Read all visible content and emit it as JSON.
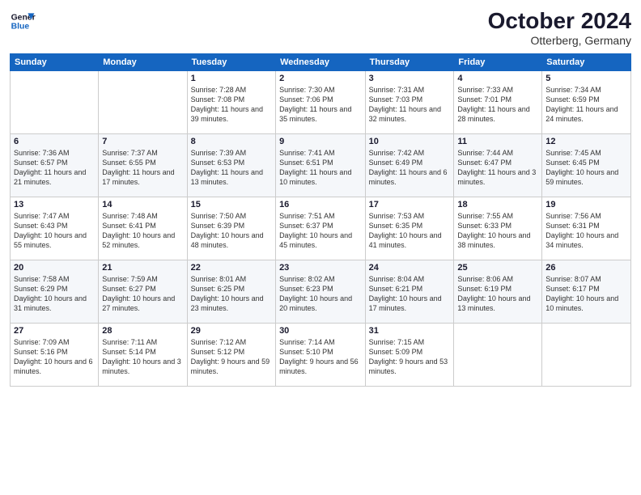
{
  "logo": {
    "line1": "General",
    "line2": "Blue"
  },
  "title": "October 2024",
  "location": "Otterberg, Germany",
  "weekdays": [
    "Sunday",
    "Monday",
    "Tuesday",
    "Wednesday",
    "Thursday",
    "Friday",
    "Saturday"
  ],
  "weeks": [
    [
      {
        "day": "",
        "info": ""
      },
      {
        "day": "",
        "info": ""
      },
      {
        "day": "1",
        "info": "Sunrise: 7:28 AM\nSunset: 7:08 PM\nDaylight: 11 hours and 39 minutes."
      },
      {
        "day": "2",
        "info": "Sunrise: 7:30 AM\nSunset: 7:06 PM\nDaylight: 11 hours and 35 minutes."
      },
      {
        "day": "3",
        "info": "Sunrise: 7:31 AM\nSunset: 7:03 PM\nDaylight: 11 hours and 32 minutes."
      },
      {
        "day": "4",
        "info": "Sunrise: 7:33 AM\nSunset: 7:01 PM\nDaylight: 11 hours and 28 minutes."
      },
      {
        "day": "5",
        "info": "Sunrise: 7:34 AM\nSunset: 6:59 PM\nDaylight: 11 hours and 24 minutes."
      }
    ],
    [
      {
        "day": "6",
        "info": "Sunrise: 7:36 AM\nSunset: 6:57 PM\nDaylight: 11 hours and 21 minutes."
      },
      {
        "day": "7",
        "info": "Sunrise: 7:37 AM\nSunset: 6:55 PM\nDaylight: 11 hours and 17 minutes."
      },
      {
        "day": "8",
        "info": "Sunrise: 7:39 AM\nSunset: 6:53 PM\nDaylight: 11 hours and 13 minutes."
      },
      {
        "day": "9",
        "info": "Sunrise: 7:41 AM\nSunset: 6:51 PM\nDaylight: 11 hours and 10 minutes."
      },
      {
        "day": "10",
        "info": "Sunrise: 7:42 AM\nSunset: 6:49 PM\nDaylight: 11 hours and 6 minutes."
      },
      {
        "day": "11",
        "info": "Sunrise: 7:44 AM\nSunset: 6:47 PM\nDaylight: 11 hours and 3 minutes."
      },
      {
        "day": "12",
        "info": "Sunrise: 7:45 AM\nSunset: 6:45 PM\nDaylight: 10 hours and 59 minutes."
      }
    ],
    [
      {
        "day": "13",
        "info": "Sunrise: 7:47 AM\nSunset: 6:43 PM\nDaylight: 10 hours and 55 minutes."
      },
      {
        "day": "14",
        "info": "Sunrise: 7:48 AM\nSunset: 6:41 PM\nDaylight: 10 hours and 52 minutes."
      },
      {
        "day": "15",
        "info": "Sunrise: 7:50 AM\nSunset: 6:39 PM\nDaylight: 10 hours and 48 minutes."
      },
      {
        "day": "16",
        "info": "Sunrise: 7:51 AM\nSunset: 6:37 PM\nDaylight: 10 hours and 45 minutes."
      },
      {
        "day": "17",
        "info": "Sunrise: 7:53 AM\nSunset: 6:35 PM\nDaylight: 10 hours and 41 minutes."
      },
      {
        "day": "18",
        "info": "Sunrise: 7:55 AM\nSunset: 6:33 PM\nDaylight: 10 hours and 38 minutes."
      },
      {
        "day": "19",
        "info": "Sunrise: 7:56 AM\nSunset: 6:31 PM\nDaylight: 10 hours and 34 minutes."
      }
    ],
    [
      {
        "day": "20",
        "info": "Sunrise: 7:58 AM\nSunset: 6:29 PM\nDaylight: 10 hours and 31 minutes."
      },
      {
        "day": "21",
        "info": "Sunrise: 7:59 AM\nSunset: 6:27 PM\nDaylight: 10 hours and 27 minutes."
      },
      {
        "day": "22",
        "info": "Sunrise: 8:01 AM\nSunset: 6:25 PM\nDaylight: 10 hours and 23 minutes."
      },
      {
        "day": "23",
        "info": "Sunrise: 8:02 AM\nSunset: 6:23 PM\nDaylight: 10 hours and 20 minutes."
      },
      {
        "day": "24",
        "info": "Sunrise: 8:04 AM\nSunset: 6:21 PM\nDaylight: 10 hours and 17 minutes."
      },
      {
        "day": "25",
        "info": "Sunrise: 8:06 AM\nSunset: 6:19 PM\nDaylight: 10 hours and 13 minutes."
      },
      {
        "day": "26",
        "info": "Sunrise: 8:07 AM\nSunset: 6:17 PM\nDaylight: 10 hours and 10 minutes."
      }
    ],
    [
      {
        "day": "27",
        "info": "Sunrise: 7:09 AM\nSunset: 5:16 PM\nDaylight: 10 hours and 6 minutes."
      },
      {
        "day": "28",
        "info": "Sunrise: 7:11 AM\nSunset: 5:14 PM\nDaylight: 10 hours and 3 minutes."
      },
      {
        "day": "29",
        "info": "Sunrise: 7:12 AM\nSunset: 5:12 PM\nDaylight: 9 hours and 59 minutes."
      },
      {
        "day": "30",
        "info": "Sunrise: 7:14 AM\nSunset: 5:10 PM\nDaylight: 9 hours and 56 minutes."
      },
      {
        "day": "31",
        "info": "Sunrise: 7:15 AM\nSunset: 5:09 PM\nDaylight: 9 hours and 53 minutes."
      },
      {
        "day": "",
        "info": ""
      },
      {
        "day": "",
        "info": ""
      }
    ]
  ]
}
